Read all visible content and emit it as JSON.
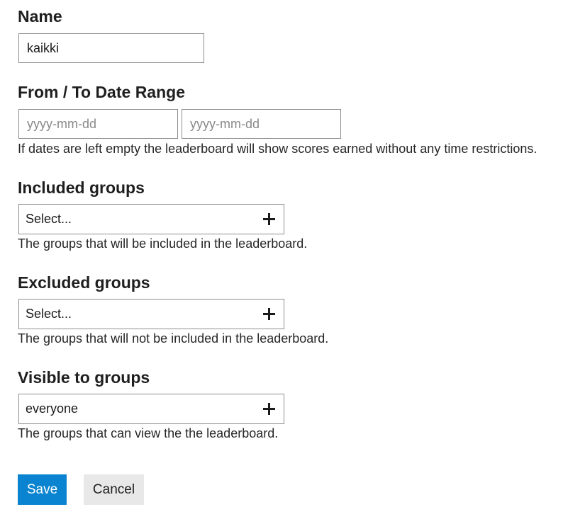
{
  "form": {
    "name": {
      "label": "Name",
      "value": "kaikki"
    },
    "date_range": {
      "label": "From / To Date Range",
      "from_placeholder": "yyyy-mm-dd",
      "to_placeholder": "yyyy-mm-dd",
      "help": "If dates are left empty the leaderboard will show scores earned without any time restrictions."
    },
    "included_groups": {
      "label": "Included groups",
      "value": "Select...",
      "help": "The groups that will be included in the leaderboard."
    },
    "excluded_groups": {
      "label": "Excluded groups",
      "value": "Select...",
      "help": "The groups that will not be included in the leaderboard."
    },
    "visible_to_groups": {
      "label": "Visible to groups",
      "value": "everyone",
      "help": "The groups that can view the the leaderboard."
    }
  },
  "actions": {
    "save_label": "Save",
    "cancel_label": "Cancel"
  },
  "colors": {
    "save_button": "#0a84d0",
    "cancel_button": "#e8e8e8",
    "border": "#8e8e8e"
  },
  "icons": {
    "add": "plus-icon"
  }
}
